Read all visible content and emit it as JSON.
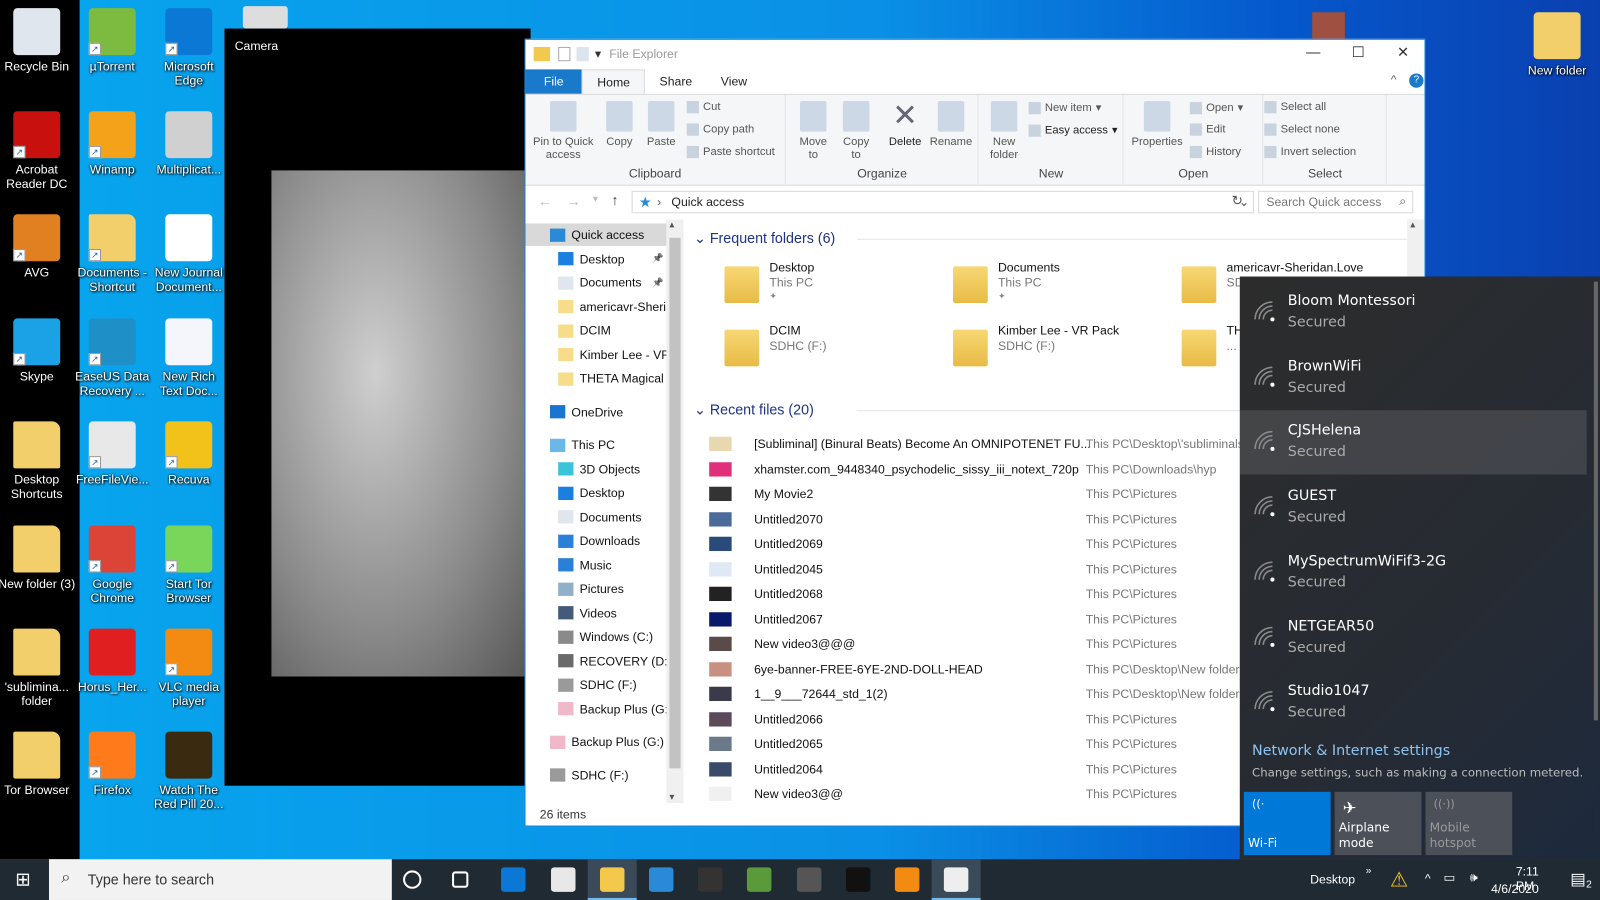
{
  "desktop": {
    "icons": [
      {
        "label": "Recycle Bin",
        "icon": "recycle-bin-icon",
        "color": "#dfe6ee",
        "col": 0,
        "row": 0,
        "shortcut": false
      },
      {
        "label": "Acrobat Reader DC",
        "icon": "acrobat-icon",
        "color": "#c8100e",
        "col": 0,
        "row": 1,
        "shortcut": true
      },
      {
        "label": "AVG",
        "icon": "avg-icon",
        "color": "#e08020",
        "col": 0,
        "row": 2,
        "shortcut": true
      },
      {
        "label": "Skype",
        "icon": "skype-icon",
        "color": "#1ba1e6",
        "col": 0,
        "row": 3,
        "shortcut": true
      },
      {
        "label": "Desktop Shortcuts",
        "icon": "folder-icon",
        "color": "#f2cf6b",
        "col": 0,
        "row": 4,
        "shortcut": false
      },
      {
        "label": "New folder (3)",
        "icon": "folder-icon",
        "color": "#f2cf6b",
        "col": 0,
        "row": 5,
        "shortcut": false
      },
      {
        "label": "'sublimina... folder",
        "icon": "folder-icon",
        "color": "#f2cf6b",
        "col": 0,
        "row": 6,
        "shortcut": false
      },
      {
        "label": "Tor Browser",
        "icon": "folder-icon",
        "color": "#f2cf6b",
        "col": 0,
        "row": 7,
        "shortcut": false
      },
      {
        "label": "µTorrent",
        "icon": "utorrent-icon",
        "color": "#7cbb3f",
        "col": 1,
        "row": 0,
        "shortcut": true
      },
      {
        "label": "Winamp",
        "icon": "winamp-icon",
        "color": "#f4a21a",
        "col": 1,
        "row": 1,
        "shortcut": true
      },
      {
        "label": "Documents - Shortcut",
        "icon": "folder-icon",
        "color": "#f2cf6b",
        "col": 1,
        "row": 2,
        "shortcut": true
      },
      {
        "label": "EaseUS Data Recovery ...",
        "icon": "easeus-icon",
        "color": "#1f8fc8",
        "col": 1,
        "row": 3,
        "shortcut": true
      },
      {
        "label": "FreeFileVie...",
        "icon": "freefileviewer-icon",
        "color": "#e8e8e8",
        "col": 1,
        "row": 4,
        "shortcut": true
      },
      {
        "label": "Google Chrome",
        "icon": "chrome-icon",
        "color": "#db4437",
        "col": 1,
        "row": 5,
        "shortcut": true
      },
      {
        "label": "Horus_Her...",
        "icon": "pdf-icon",
        "color": "#e02020",
        "col": 1,
        "row": 6,
        "shortcut": false
      },
      {
        "label": "Firefox",
        "icon": "firefox-icon",
        "color": "#ff7a1a",
        "col": 1,
        "row": 7,
        "shortcut": true
      },
      {
        "label": "Microsoft Edge",
        "icon": "edge-icon",
        "color": "#0a78d4",
        "col": 2,
        "row": 0,
        "shortcut": true
      },
      {
        "label": "Multiplicat...",
        "icon": "image-file-icon",
        "color": "#d0d0d0",
        "col": 2,
        "row": 1,
        "shortcut": false
      },
      {
        "label": "New Journal Document...",
        "icon": "document-icon",
        "color": "#ffffff",
        "col": 2,
        "row": 2,
        "shortcut": false
      },
      {
        "label": "New Rich Text Doc...",
        "icon": "rtf-document-icon",
        "color": "#f4f6fb",
        "col": 2,
        "row": 3,
        "shortcut": false
      },
      {
        "label": "Recuva",
        "icon": "recuva-icon",
        "color": "#f2c21a",
        "col": 2,
        "row": 4,
        "shortcut": true
      },
      {
        "label": "Start Tor Browser",
        "icon": "tor-icon",
        "color": "#7ad65a",
        "col": 2,
        "row": 5,
        "shortcut": true
      },
      {
        "label": "VLC media player",
        "icon": "vlc-icon",
        "color": "#f38a12",
        "col": 2,
        "row": 6,
        "shortcut": true
      },
      {
        "label": "Watch The Red Pill 20...",
        "icon": "video-file-icon",
        "color": "#3a2a10",
        "col": 2,
        "row": 7,
        "shortcut": false
      }
    ],
    "top_right_icon": {
      "label": "New folder",
      "icon": "folder-icon"
    }
  },
  "camera": {
    "title": "Camera"
  },
  "explorer": {
    "title": "File Explorer",
    "tabs": [
      "File",
      "Home",
      "Share",
      "View"
    ],
    "ribbon": {
      "clipboard": {
        "label": "Clipboard",
        "pin": "Pin to Quick access",
        "copy": "Copy",
        "paste": "Paste",
        "cut": "Cut",
        "copy_path": "Copy path",
        "paste_shortcut": "Paste shortcut"
      },
      "organize": {
        "label": "Organize",
        "move_to": "Move to",
        "copy_to": "Copy to",
        "delete": "Delete",
        "rename": "Rename"
      },
      "new": {
        "label": "New",
        "new_folder": "New folder",
        "new_item": "New item",
        "easy_access": "Easy access"
      },
      "open": {
        "label": "Open",
        "properties": "Properties",
        "open": "Open",
        "edit": "Edit",
        "history": "History"
      },
      "select": {
        "label": "Select",
        "select_all": "Select all",
        "select_none": "Select none",
        "invert": "Invert selection"
      }
    },
    "address": "Quick access",
    "search_placeholder": "Search Quick access",
    "nav": [
      {
        "label": "Quick access",
        "indent": 0,
        "icon": "star-icon",
        "color": "#2a8ad8",
        "selected": true,
        "gap": 0
      },
      {
        "label": "Desktop",
        "indent": 1,
        "icon": "desktop-icon",
        "color": "#1a7fe0",
        "pinned": true
      },
      {
        "label": "Documents",
        "indent": 1,
        "icon": "documents-icon",
        "color": "#dfe6ee",
        "pinned": true
      },
      {
        "label": "americavr-Sheridan.Love",
        "indent": 1,
        "icon": "folder-icon",
        "color": "#f7dc8a"
      },
      {
        "label": "DCIM",
        "indent": 1,
        "icon": "folder-icon",
        "color": "#f7dc8a"
      },
      {
        "label": "Kimber Lee - VR Pack",
        "indent": 1,
        "icon": "folder-icon",
        "color": "#f7dc8a"
      },
      {
        "label": "THETA Magical Fantasy",
        "indent": 1,
        "icon": "folder-icon",
        "color": "#f7dc8a"
      },
      {
        "label": "OneDrive",
        "indent": 0,
        "icon": "onedrive-icon",
        "color": "#1a74d0",
        "gap": 1
      },
      {
        "label": "This PC",
        "indent": 0,
        "icon": "pc-icon",
        "color": "#6ab8ea",
        "gap": 1
      },
      {
        "label": "3D Objects",
        "indent": 1,
        "icon": "3d-objects-icon",
        "color": "#3bc4d8"
      },
      {
        "label": "Desktop",
        "indent": 1,
        "icon": "desktop-icon",
        "color": "#1a7fe0"
      },
      {
        "label": "Documents",
        "indent": 1,
        "icon": "documents-icon",
        "color": "#dfe6ee"
      },
      {
        "label": "Downloads",
        "indent": 1,
        "icon": "downloads-icon",
        "color": "#2a7fd8"
      },
      {
        "label": "Music",
        "indent": 1,
        "icon": "music-icon",
        "color": "#2a7fd8"
      },
      {
        "label": "Pictures",
        "indent": 1,
        "icon": "pictures-icon",
        "color": "#8fb0c8"
      },
      {
        "label": "Videos",
        "indent": 1,
        "icon": "videos-icon",
        "color": "#445a78"
      },
      {
        "label": "Windows (C:)",
        "indent": 1,
        "icon": "drive-icon",
        "color": "#8a8a8a"
      },
      {
        "label": "RECOVERY (D:)",
        "indent": 1,
        "icon": "drive-icon",
        "color": "#6a6a6a"
      },
      {
        "label": "SDHC (F:)",
        "indent": 1,
        "icon": "sd-card-icon",
        "color": "#9a9a9a"
      },
      {
        "label": "Backup Plus (G:)",
        "indent": 1,
        "icon": "external-drive-icon",
        "color": "#f0b8c8"
      },
      {
        "label": "Backup Plus (G:)",
        "indent": 0,
        "icon": "external-drive-icon",
        "color": "#f0b8c8",
        "gap": 1
      },
      {
        "label": "SDHC (F:)",
        "indent": 0,
        "icon": "sd-card-icon",
        "color": "#9a9a9a",
        "gap": 1
      }
    ],
    "frequent_title": "Frequent folders (6)",
    "frequent": [
      {
        "name": "Desktop",
        "sub": "This PC",
        "pinned": true
      },
      {
        "name": "Documents",
        "sub": "This PC",
        "pinned": true
      },
      {
        "name": "americavr-Sheridan.Love",
        "sub": "SDHC (F:)"
      },
      {
        "name": "DCIM",
        "sub": "SDHC (F:)"
      },
      {
        "name": "Kimber Lee - VR Pack",
        "sub": "SDHC (F:)"
      },
      {
        "name": "THETA Magical Fantasy",
        "sub": "..."
      }
    ],
    "recent_title": "Recent files (20)",
    "recent": [
      {
        "name": "[Subliminal] (Binural Beats) Become An OMNIPOTENET FU...",
        "path": "This PC\\Desktop\\'subliminals"
      },
      {
        "name": "xhamster.com_9448340_psychodelic_sissy_iii_notext_720p",
        "path": "This PC\\Downloads\\hyp"
      },
      {
        "name": "My Movie2",
        "path": "This PC\\Pictures"
      },
      {
        "name": "Untitled2070",
        "path": "This PC\\Pictures"
      },
      {
        "name": "Untitled2069",
        "path": "This PC\\Pictures"
      },
      {
        "name": "Untitled2045",
        "path": "This PC\\Pictures"
      },
      {
        "name": "Untitled2068",
        "path": "This PC\\Pictures"
      },
      {
        "name": "Untitled2067",
        "path": "This PC\\Pictures"
      },
      {
        "name": "New video3@@@",
        "path": "This PC\\Pictures"
      },
      {
        "name": "6ye-banner-FREE-6YE-2ND-DOLL-HEAD",
        "path": "This PC\\Desktop\\New folder"
      },
      {
        "name": "1__9___72644_std_1(2)",
        "path": "This PC\\Desktop\\New folder"
      },
      {
        "name": "Untitled2066",
        "path": "This PC\\Pictures"
      },
      {
        "name": "Untitled2065",
        "path": "This PC\\Pictures"
      },
      {
        "name": "Untitled2064",
        "path": "This PC\\Pictures"
      },
      {
        "name": "New video3@@",
        "path": "This PC\\Pictures"
      }
    ],
    "status": "26 items"
  },
  "wifi": {
    "networks": [
      {
        "name": "Bloom Montessori",
        "status": "Secured"
      },
      {
        "name": "BrownWiFi",
        "status": "Secured"
      },
      {
        "name": "CJSHelena",
        "status": "Secured",
        "highlighted": true
      },
      {
        "name": "GUEST",
        "status": "Secured"
      },
      {
        "name": "MySpectrumWiFif3-2G",
        "status": "Secured"
      },
      {
        "name": "NETGEAR50",
        "status": "Secured"
      },
      {
        "name": "Studio1047",
        "status": "Secured"
      }
    ],
    "settings_link": "Network & Internet settings",
    "settings_desc": "Change settings, such as making a connection metered.",
    "quick_actions": [
      {
        "label": "Wi-Fi",
        "icon": "wifi-icon",
        "active": true
      },
      {
        "label": "Airplane mode",
        "icon": "airplane-icon",
        "active": false
      },
      {
        "label": "Mobile hotspot",
        "icon": "hotspot-icon",
        "active": false,
        "disabled": true
      }
    ],
    "accent": "#0078d7"
  },
  "taskbar": {
    "search_placeholder": "Type here to search",
    "apps": [
      {
        "icon": "cortana-icon",
        "color": "transparent"
      },
      {
        "icon": "task-view-icon",
        "color": "transparent"
      },
      {
        "icon": "edge-icon",
        "color": "#0a78d4"
      },
      {
        "icon": "store-icon",
        "color": "#e8e8e8"
      },
      {
        "icon": "file-explorer-icon",
        "color": "#f2c94c",
        "active": true
      },
      {
        "icon": "mail-icon",
        "color": "#2a8ad8"
      },
      {
        "icon": "amazon-icon",
        "color": "#333"
      },
      {
        "icon": "tripadvisor-icon",
        "color": "#5a9a3a"
      },
      {
        "icon": "webcam-app-icon",
        "color": "#555"
      },
      {
        "icon": "color-app-icon",
        "color": "#111"
      },
      {
        "icon": "vlc-icon",
        "color": "#f38a12"
      },
      {
        "icon": "camera-icon",
        "color": "#eee",
        "active": true
      }
    ],
    "desktop_label": "Desktop",
    "time": "7:11 PM",
    "date": "4/6/2020",
    "notification_count": "2"
  }
}
